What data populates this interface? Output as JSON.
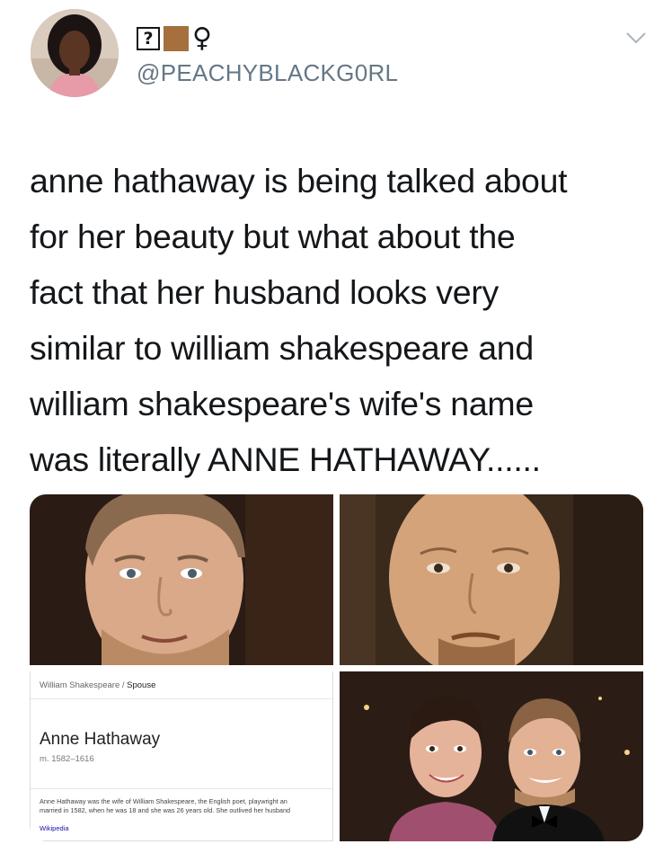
{
  "author": {
    "display_name_glyph_box": "?",
    "display_name_symbol": "♀",
    "handle": "@PEACHYBLACKG0RL",
    "skin_tone_color": "#a5703e"
  },
  "tweet": {
    "text_lines": [
      "anne hathaway is being talked about",
      "for her beauty but what about the",
      "fact that her husband looks very",
      "similar to william shakespeare and",
      "william shakespeare's wife's name",
      "was literally ANNE HATHAWAY......"
    ]
  },
  "knowledge_panel": {
    "breadcrumb_parent": "William Shakespeare / ",
    "breadcrumb_current": "Spouse",
    "name": "Anne Hathaway",
    "years": "m. 1582–1616",
    "description_line1": "Anne Hathaway was the wife of William Shakespeare, the English poet, playwright an",
    "description_line2": "married in 1582, when he was 18 and she was 26 years old. She outlived her husband",
    "source": "Wikipedia"
  },
  "icons": {
    "caret": "chevron-down-icon"
  },
  "colors": {
    "text": "#14171a",
    "secondary": "#657786",
    "link": "#1a0dab"
  }
}
